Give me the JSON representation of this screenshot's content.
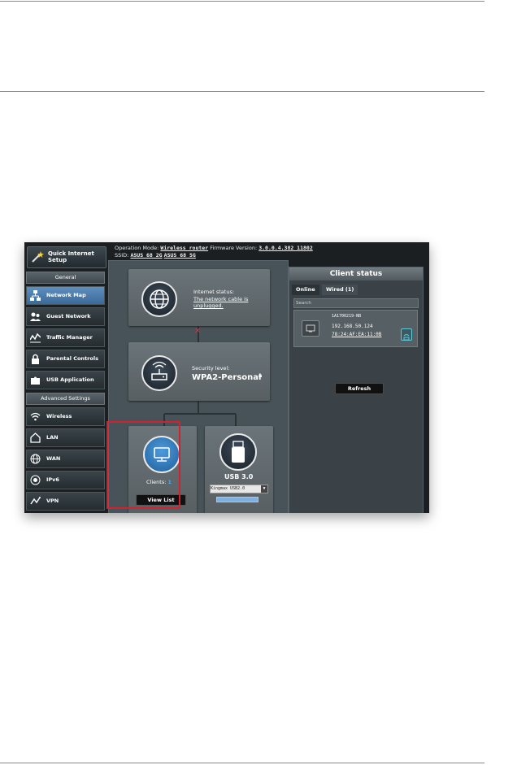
{
  "topbar": {
    "quick_setup_label": "Quick Internet Setup",
    "op_mode_label": "Operation Mode:",
    "op_mode_value": "Wireless router",
    "firmware_label": "Firmware Version:",
    "firmware_value": "3.0.0.4.382_11802",
    "ssid_label": "SSID:",
    "ssid_2g": "ASUS_68_2G",
    "ssid_5g": "ASUS_68_5G"
  },
  "sidebar": {
    "general_header": "General",
    "general_items": [
      {
        "label": "Network Map",
        "icon": "network-map-icon"
      },
      {
        "label": "Guest Network",
        "icon": "guest-network-icon"
      },
      {
        "label": "Traffic Manager",
        "icon": "traffic-manager-icon"
      },
      {
        "label": "Parental Controls",
        "icon": "parental-controls-icon"
      },
      {
        "label": "USB Application",
        "icon": "usb-application-icon"
      }
    ],
    "advanced_header": "Advanced Settings",
    "advanced_items": [
      {
        "label": "Wireless",
        "icon": "wireless-icon"
      },
      {
        "label": "LAN",
        "icon": "lan-icon"
      },
      {
        "label": "WAN",
        "icon": "wan-icon"
      },
      {
        "label": "IPv6",
        "icon": "ipv6-icon"
      },
      {
        "label": "VPN",
        "icon": "vpn-icon"
      }
    ]
  },
  "map": {
    "internet_status_label": "Internet status:",
    "internet_status_value": "The network cable is unplugged.",
    "security_label": "Security level:",
    "security_value": "WPA2-Personal",
    "clients_label": "Clients:",
    "clients_count": "1",
    "view_list_label": "View List",
    "usb_label": "USB 3.0",
    "usb_device": "Kingmax USB2.0"
  },
  "client_status": {
    "title": "Client status",
    "tab_online": "Online",
    "tab_wired": "Wired (1)",
    "search_placeholder": "Search",
    "client_name": "1A1700219-NB",
    "client_ip": "192.168.50.124",
    "client_mac": "78:24:AF:EA:11:0B",
    "refresh_label": "Refresh"
  },
  "colors": {
    "active_item": "#4a7dad",
    "highlight_box": "#d0232f",
    "usb_bar": "#7fb0e0"
  }
}
